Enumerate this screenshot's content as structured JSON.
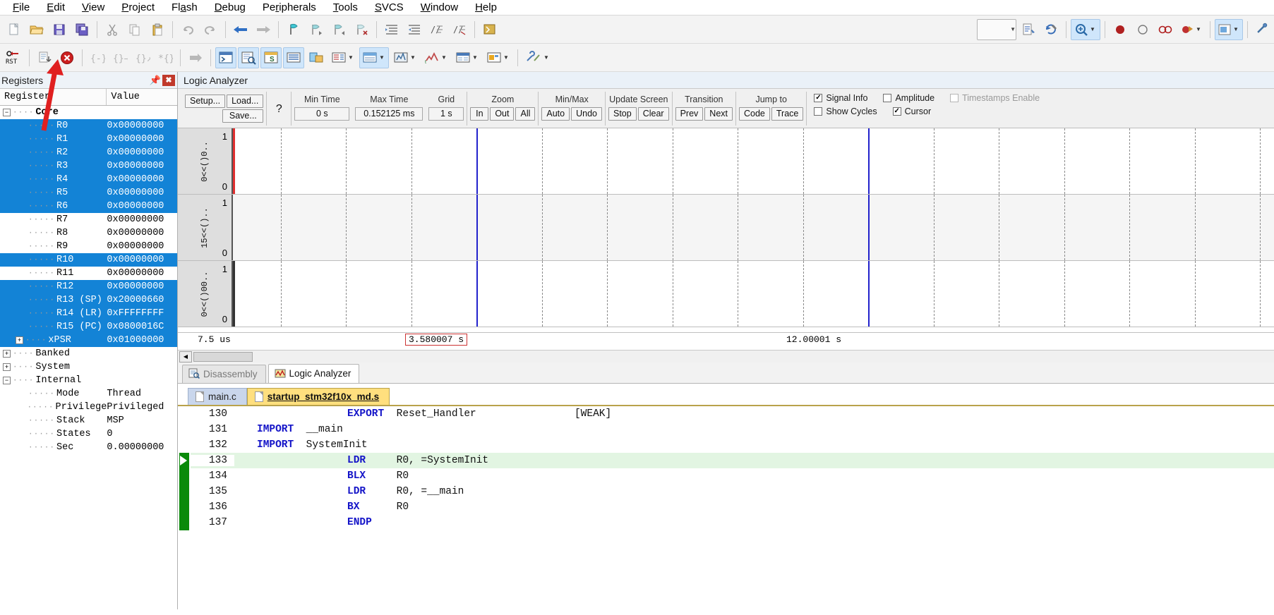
{
  "app": {
    "menu": [
      {
        "label": "File",
        "mnemonic": "F"
      },
      {
        "label": "Edit",
        "mnemonic": "E"
      },
      {
        "label": "View",
        "mnemonic": "V"
      },
      {
        "label": "Project",
        "mnemonic": "P"
      },
      {
        "label": "Flash",
        "mnemonic": "a"
      },
      {
        "label": "Debug",
        "mnemonic": "D"
      },
      {
        "label": "Peripherals",
        "mnemonic": "r"
      },
      {
        "label": "Tools",
        "mnemonic": "T"
      },
      {
        "label": "SVCS",
        "mnemonic": "S"
      },
      {
        "label": "Window",
        "mnemonic": "W"
      },
      {
        "label": "Help",
        "mnemonic": "H"
      }
    ]
  },
  "toolbar1": {
    "icons": [
      "new-file-icon",
      "open-folder-icon",
      "save-icon",
      "save-all-icon",
      "cut-icon",
      "copy-icon",
      "paste-icon",
      "undo-icon",
      "redo-icon",
      "navigate-back-icon",
      "navigate-forward-icon",
      "bookmark-toggle-icon",
      "bookmark-prev-icon",
      "bookmark-next-icon",
      "bookmark-clear-icon",
      "indent-icon",
      "outdent-icon",
      "comment-icon",
      "uncomment-icon",
      "find-in-files-icon"
    ],
    "right_icons": [
      "target-select-dropdown",
      "build-target-icon",
      "rebuild-icon",
      "debug-session-icon",
      "insert-breakpoint-icon",
      "disable-breakpoint-icon",
      "disable-all-breakpoints-icon",
      "kill-all-breakpoints-icon",
      "manage-components-icon",
      "configure-icon"
    ]
  },
  "toolbar2": {
    "icons": [
      "reset-icon",
      "run-to-main-icon",
      "stop-icon",
      "step-into-icon",
      "step-over-icon",
      "step-out-icon",
      "run-to-cursor-icon",
      "show-next-statement-icon",
      "command-window-icon",
      "disassembly-window-icon",
      "symbols-window-icon",
      "registers-window-icon",
      "call-stack-icon",
      "watch-window-icon",
      "memory-window-icon",
      "serial-window-icon",
      "analysis-window-icon",
      "trace-window-icon",
      "system-viewer-icon",
      "toolbox-icon"
    ]
  },
  "registers": {
    "title": "Registers",
    "pin_icon": "pin-icon",
    "close_icon": "close-icon",
    "columns": [
      "Register",
      "Value"
    ],
    "rows": [
      {
        "name": "Core",
        "value": "",
        "level": 0,
        "expander": "-",
        "selected": false,
        "bold": true
      },
      {
        "name": "R0",
        "value": "0x00000000",
        "level": 2,
        "selected": true
      },
      {
        "name": "R1",
        "value": "0x00000000",
        "level": 2,
        "selected": true
      },
      {
        "name": "R2",
        "value": "0x00000000",
        "level": 2,
        "selected": true
      },
      {
        "name": "R3",
        "value": "0x00000000",
        "level": 2,
        "selected": true
      },
      {
        "name": "R4",
        "value": "0x00000000",
        "level": 2,
        "selected": true
      },
      {
        "name": "R5",
        "value": "0x00000000",
        "level": 2,
        "selected": true
      },
      {
        "name": "R6",
        "value": "0x00000000",
        "level": 2,
        "selected": true
      },
      {
        "name": "R7",
        "value": "0x00000000",
        "level": 2,
        "selected": false
      },
      {
        "name": "R8",
        "value": "0x00000000",
        "level": 2,
        "selected": false
      },
      {
        "name": "R9",
        "value": "0x00000000",
        "level": 2,
        "selected": false
      },
      {
        "name": "R10",
        "value": "0x00000000",
        "level": 2,
        "selected": true
      },
      {
        "name": "R11",
        "value": "0x00000000",
        "level": 2,
        "selected": false
      },
      {
        "name": "R12",
        "value": "0x00000000",
        "level": 2,
        "selected": true
      },
      {
        "name": "R13 (SP)",
        "value": "0x20000660",
        "level": 2,
        "selected": true
      },
      {
        "name": "R14 (LR)",
        "value": "0xFFFFFFFF",
        "level": 2,
        "selected": true
      },
      {
        "name": "R15 (PC)",
        "value": "0x0800016C",
        "level": 2,
        "selected": true
      },
      {
        "name": "xPSR",
        "value": "0x01000000",
        "level": 1,
        "expander": "+",
        "selected": true
      },
      {
        "name": "Banked",
        "value": "",
        "level": 0,
        "expander": "+",
        "selected": false
      },
      {
        "name": "System",
        "value": "",
        "level": 0,
        "expander": "+",
        "selected": false
      },
      {
        "name": "Internal",
        "value": "",
        "level": 0,
        "expander": "-",
        "selected": false
      },
      {
        "name": "Mode",
        "value": "Thread",
        "level": 2,
        "selected": false
      },
      {
        "name": "Privilege",
        "value": "Privileged",
        "level": 2,
        "selected": false
      },
      {
        "name": "Stack",
        "value": "MSP",
        "level": 2,
        "selected": false
      },
      {
        "name": "States",
        "value": "0",
        "level": 2,
        "selected": false
      },
      {
        "name": "Sec",
        "value": "0.00000000",
        "level": 2,
        "selected": false
      }
    ]
  },
  "logic_analyzer": {
    "title": "Logic Analyzer",
    "buttons": {
      "setup": "Setup...",
      "load": "Load...",
      "save": "Save...",
      "help": "?"
    },
    "fields": [
      {
        "label": "Min Time",
        "value": "0 s",
        "name": "min-time"
      },
      {
        "label": "Max Time",
        "value": "0.152125 ms",
        "name": "max-time"
      },
      {
        "label": "Grid",
        "value": "1 s",
        "name": "grid"
      }
    ],
    "groups": [
      {
        "label": "Zoom",
        "buttons": [
          "In",
          "Out",
          "All"
        ]
      },
      {
        "label": "Min/Max",
        "buttons": [
          "Auto",
          "Undo"
        ]
      },
      {
        "label": "Update Screen",
        "buttons": [
          "Stop",
          "Clear"
        ]
      },
      {
        "label": "Transition",
        "buttons": [
          "Prev",
          "Next"
        ]
      },
      {
        "label": "Jump to",
        "buttons": [
          "Code",
          "Trace"
        ]
      }
    ],
    "checkboxes": [
      {
        "label": "Signal Info",
        "checked": true,
        "disabled": false
      },
      {
        "label": "Amplitude",
        "checked": false,
        "disabled": false
      },
      {
        "label": "Timestamps Enable",
        "checked": false,
        "disabled": true
      },
      {
        "label": "Show Cycles",
        "checked": false,
        "disabled": false
      },
      {
        "label": "Cursor",
        "checked": true,
        "disabled": false
      }
    ],
    "tracks": [
      {
        "label": "0<<()0..",
        "max": "1",
        "min": "0",
        "marker": "red"
      },
      {
        "label": "15<<()..",
        "max": "1",
        "min": "0",
        "marker": "none"
      },
      {
        "label": "0<<()00..",
        "max": "1",
        "min": "0",
        "marker": "black"
      }
    ],
    "axis": {
      "left": "7.5 us",
      "cursor": "3.580007 s",
      "right": "12.00001 s"
    }
  },
  "view_tabs": [
    {
      "label": "Disassembly",
      "icon": "disassembly-icon",
      "active": false
    },
    {
      "label": "Logic Analyzer",
      "icon": "logic-analyzer-icon",
      "active": true
    }
  ],
  "file_tabs": [
    {
      "label": "main.c",
      "active": false
    },
    {
      "label": "startup_stm32f10x_md.s",
      "active": true
    }
  ],
  "code": {
    "lines": [
      {
        "no": "130",
        "indent": 20,
        "tokens": [
          {
            "t": "EXPORT",
            "c": "kw"
          },
          {
            "t": "  Reset_Handler",
            "c": "id"
          },
          {
            "t": "                ",
            "c": "id"
          },
          {
            "t": "[WEAK]",
            "c": "wk"
          }
        ],
        "exec": false
      },
      {
        "no": "131",
        "indent": 4,
        "tokens": [
          {
            "t": "IMPORT",
            "c": "kw"
          },
          {
            "t": "  __main",
            "c": "id"
          }
        ],
        "exec": false
      },
      {
        "no": "132",
        "indent": 4,
        "tokens": [
          {
            "t": "IMPORT",
            "c": "kw"
          },
          {
            "t": "  SystemInit",
            "c": "id"
          }
        ],
        "exec": false
      },
      {
        "no": "133",
        "indent": 20,
        "tokens": [
          {
            "t": "LDR",
            "c": "kw"
          },
          {
            "t": "     R0, =SystemInit",
            "c": "id"
          }
        ],
        "exec": true
      },
      {
        "no": "134",
        "indent": 20,
        "tokens": [
          {
            "t": "BLX",
            "c": "kw"
          },
          {
            "t": "     R0",
            "c": "id"
          }
        ],
        "exec": false
      },
      {
        "no": "135",
        "indent": 20,
        "tokens": [
          {
            "t": "LDR",
            "c": "kw"
          },
          {
            "t": "     R0, =__main",
            "c": "id"
          }
        ],
        "exec": false
      },
      {
        "no": "136",
        "indent": 20,
        "tokens": [
          {
            "t": "BX",
            "c": "kw"
          },
          {
            "t": "      R0",
            "c": "id"
          }
        ],
        "exec": false
      },
      {
        "no": "137",
        "indent": 20,
        "tokens": [
          {
            "t": "ENDP",
            "c": "kw"
          }
        ],
        "exec": false
      }
    ]
  },
  "annotation": {
    "type": "red-arrow",
    "color": "#e02020"
  },
  "colors": {
    "selection_blue": "#1383d6",
    "exec_green": "#0a8a0a",
    "exec_row": "#e2f5e2",
    "active_tab_yellow": "#ffdf7e",
    "inactive_tab_blue": "#c9d6ec",
    "cursor_blue": "#2222cc",
    "keyword_blue": "#1414c8"
  }
}
